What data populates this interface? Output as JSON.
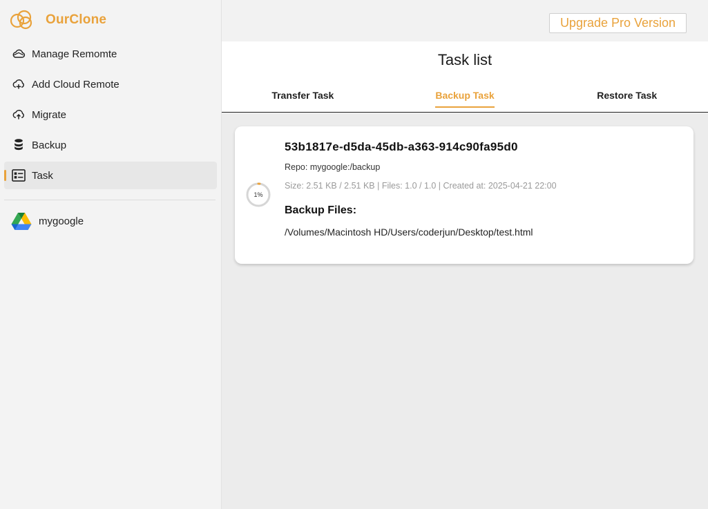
{
  "app": {
    "name": "OurClone",
    "upgrade_label": "Upgrade Pro Version"
  },
  "sidebar": {
    "items": [
      {
        "label": "Manage Remomte",
        "icon": "cloud-icon"
      },
      {
        "label": "Add Cloud Remote",
        "icon": "cloud-add-icon"
      },
      {
        "label": "Migrate",
        "icon": "cloud-upload-icon"
      },
      {
        "label": "Backup",
        "icon": "database-icon"
      },
      {
        "label": "Task",
        "icon": "task-list-icon",
        "active": true
      }
    ],
    "remotes": [
      {
        "label": "mygoogle",
        "icon": "google-drive-icon"
      }
    ]
  },
  "main": {
    "title": "Task list",
    "tabs": [
      {
        "label": "Transfer Task"
      },
      {
        "label": "Backup Task",
        "active": true
      },
      {
        "label": "Restore Task"
      }
    ]
  },
  "tasks": [
    {
      "id": "53b1817e-d5da-45db-a363-914c90fa95d0",
      "repo": "Repo: mygoogle:/backup",
      "meta": "Size: 2.51 KB / 2.51 KB | Files: 1.0 / 1.0 | Created at: 2025-04-21 22:00",
      "progress_label": "1%",
      "progress": 0.01,
      "files_title": "Backup Files:",
      "files": [
        "/Volumes/Macintosh HD/Users/coderjun/Desktop/test.html"
      ]
    }
  ],
  "colors": {
    "accent": "#e9a23b",
    "progress_track": "#d6d6d6"
  }
}
